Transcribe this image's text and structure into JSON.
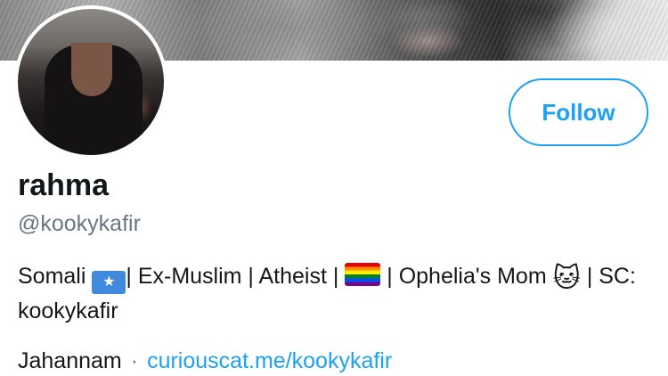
{
  "profile": {
    "display_name": "rahma",
    "handle": "@kookykafir",
    "follow_label": "Follow",
    "bio": {
      "part1": "Somali ",
      "flag_somalia_symbol": "★",
      "part2": "| Ex-Muslim | Atheist | ",
      "part3": " | Ophelia's Mom ",
      "cat_emoji": "🐱",
      "part4": " | SC: kookykafir"
    },
    "location": "Jahannam",
    "separator": "·",
    "website": "curiouscat.me/kookykafir"
  },
  "colors": {
    "accent": "#1da1f2",
    "secondary_text": "#657786",
    "primary_text": "#14171a"
  },
  "icons": {
    "flag_somalia": "somalia-flag-icon",
    "rainbow_flag": "rainbow-flag-icon",
    "cat_face": "cat-face-icon"
  }
}
